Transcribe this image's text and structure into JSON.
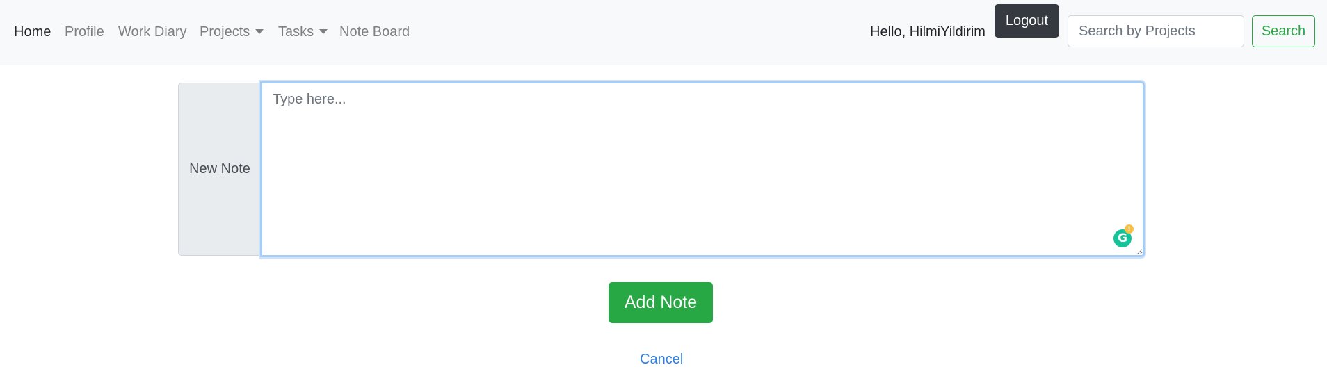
{
  "nav": {
    "items": [
      {
        "label": "Home",
        "active": true
      },
      {
        "label": "Profile"
      },
      {
        "label": "Work Diary"
      },
      {
        "label": "Projects",
        "dropdown": true
      },
      {
        "label": "Tasks",
        "dropdown": true
      },
      {
        "label": "Note Board"
      }
    ],
    "greeting": "Hello, HilmiYildirim",
    "logout_label": "Logout",
    "search_placeholder": "Search by Projects",
    "search_label": "Search"
  },
  "form": {
    "note_label": "New Note",
    "note_placeholder": "Type here...",
    "note_value": "",
    "grammarly_letter": "G",
    "grammarly_badge": "!",
    "add_label": "Add Note",
    "cancel_label": "Cancel"
  },
  "colors": {
    "navbar_bg": "#f8f9fa",
    "success": "#28a745",
    "dark": "#343a40",
    "link": "#2f7fe0"
  }
}
